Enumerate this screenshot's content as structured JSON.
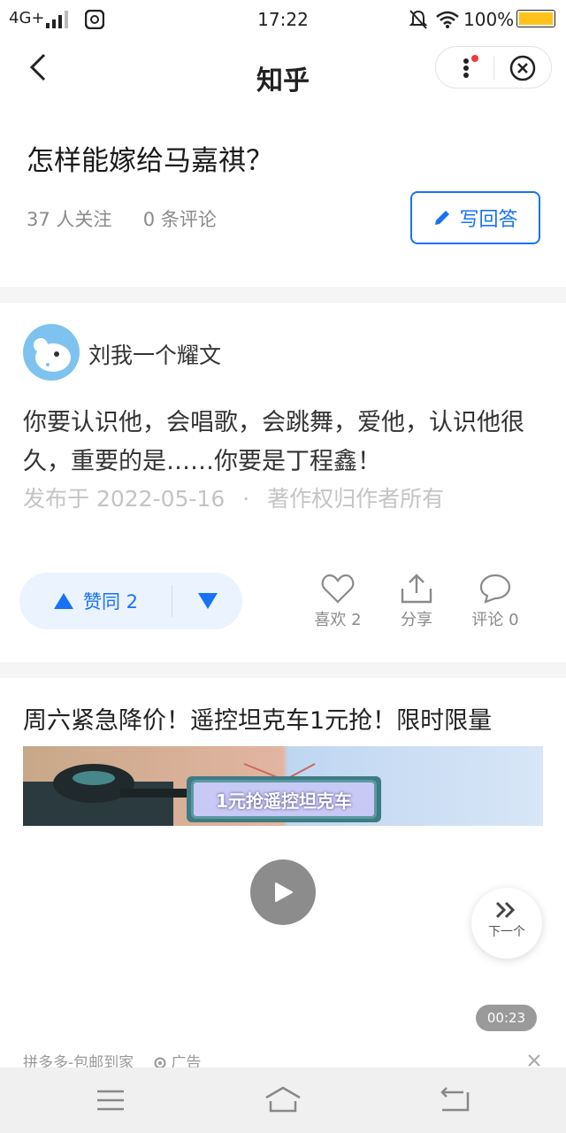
{
  "status_bar": {
    "network": "4G+",
    "time": "17:22",
    "battery": "100%"
  },
  "nav": {
    "title": "知乎"
  },
  "question": {
    "title": "怎样能嫁给马嘉祺？",
    "followers": "37 人关注",
    "comments": "0 条评论",
    "write_answer_label": "写回答"
  },
  "answer": {
    "author": "刘我一个耀文",
    "content": "你要认识他，会唱歌，会跳舞，爱他，认识他很久，重要的是……你要是丁程鑫！",
    "published": "发布于 2022-05-16",
    "separator": "·",
    "copyright": "著作权归作者所有",
    "upvote_label": "赞同 2",
    "like_label": "喜欢 2",
    "share_label": "分享",
    "comment_label": "评论 0"
  },
  "ad": {
    "title": "周六紧急降价！遥控坦克车1元抢！限时限量",
    "banner_text": "1元抢遥控坦克车",
    "next_label": "下一个",
    "duration": "00:23",
    "source": "拼多多-包邮到家",
    "ad_label": "广告"
  },
  "colors": {
    "accent": "#1772f6",
    "vote_bg": "#ebf3ff",
    "battery": "#ffc21a"
  }
}
